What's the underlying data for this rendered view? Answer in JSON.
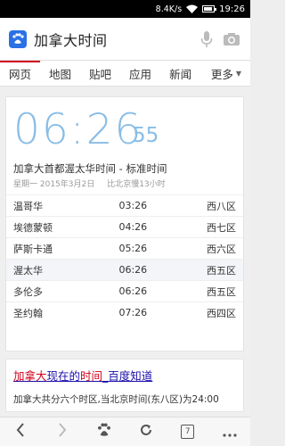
{
  "statusbar": {
    "net_speed": "8.4K/s",
    "time": "19:26"
  },
  "search": {
    "query": "加拿大时间"
  },
  "tabs": [
    {
      "label": "网页",
      "active": true
    },
    {
      "label": "地图"
    },
    {
      "label": "贴吧"
    },
    {
      "label": "应用"
    },
    {
      "label": "新闻"
    },
    {
      "label": "更多"
    }
  ],
  "clock": {
    "hm": "06:26",
    "sec": "55",
    "title": "加拿大首都渥太华时间 - 标准时间",
    "weekday_date": "星期一 2015年3月2日",
    "offset": "比北京慢13小时"
  },
  "cities": [
    {
      "name": "温哥华",
      "time": "03:26",
      "zone": "西八区"
    },
    {
      "name": "埃德蒙顿",
      "time": "04:26",
      "zone": "西七区"
    },
    {
      "name": "萨斯卡通",
      "time": "05:26",
      "zone": "西六区"
    },
    {
      "name": "渥太华",
      "time": "06:26",
      "zone": "西五区",
      "highlight": true
    },
    {
      "name": "多伦多",
      "time": "06:26",
      "zone": "西五区"
    },
    {
      "name": "圣约翰",
      "time": "07:26",
      "zone": "西四区"
    }
  ],
  "result2": {
    "link_red": "加拿大",
    "link_rest_a": "现在的",
    "link_red2": "时间",
    "link_rest_b": "_百度知道",
    "snippet": "加拿大共分六个时区,当北京时间(东八区)为24:00"
  },
  "toolbar": {
    "tabs_count": "7"
  }
}
